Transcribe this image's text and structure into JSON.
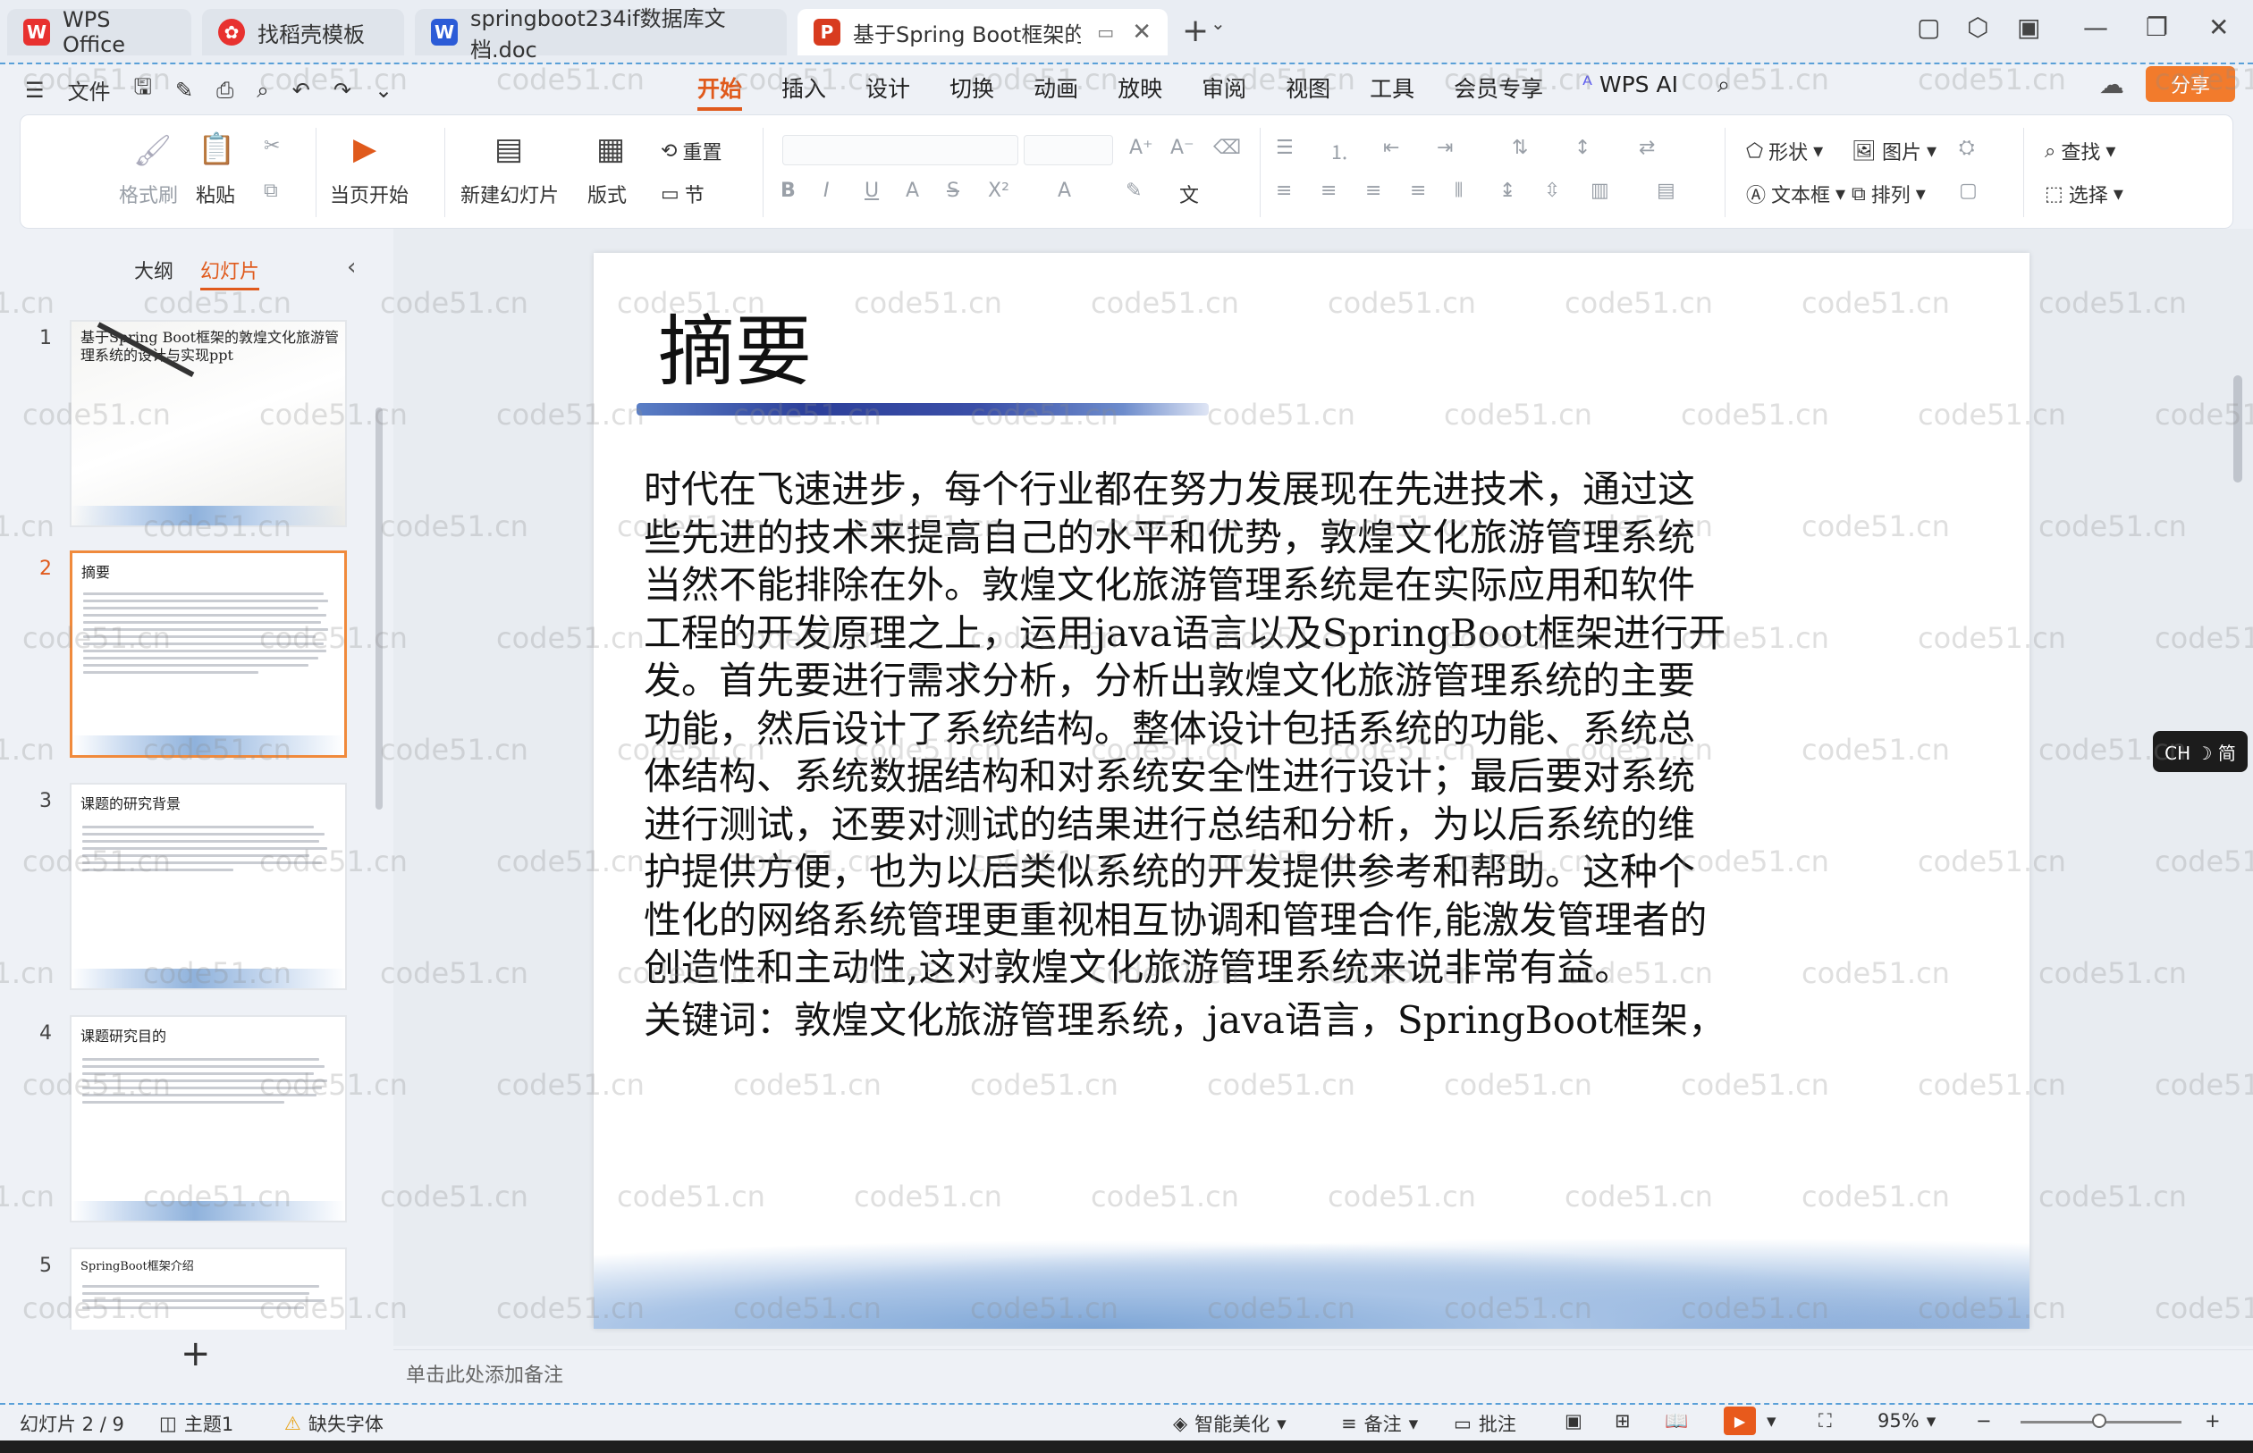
{
  "tabs": [
    {
      "label": "WPS Office",
      "icon": "wps-logo-icon",
      "active": false
    },
    {
      "label": "找稻壳模板",
      "icon": "docer-icon",
      "active": false
    },
    {
      "label": "springboot234if数据库文档.doc",
      "icon": "word-doc-icon",
      "active": false
    },
    {
      "label": "基于Spring Boot框架的敦煌",
      "icon": "ppt-doc-icon",
      "active": true
    }
  ],
  "menu": {
    "file_label": "文件",
    "tabs": [
      "开始",
      "插入",
      "设计",
      "切换",
      "动画",
      "放映",
      "审阅",
      "视图",
      "工具",
      "会员专享"
    ],
    "active_tab": "开始",
    "wps_ai_label": "WPS AI",
    "share_label": "分享"
  },
  "ribbon": {
    "format_painter": "格式刷",
    "paste": "粘贴",
    "from_current": "当页开始",
    "new_slide": "新建幻灯片",
    "layout": "版式",
    "reset": "重置",
    "section": "节",
    "shape": "形状",
    "picture": "图片",
    "textbox": "文本框",
    "arrange": "排列",
    "find": "查找",
    "select": "选择"
  },
  "left_panel": {
    "outline_tab": "大纲",
    "slides_tab": "幻灯片",
    "active_tab": "幻灯片",
    "thumbnails": [
      {
        "num": "1",
        "title": "基于Spring Boot框架的敦煌文化旅游管理系统的设计与实现ppt"
      },
      {
        "num": "2",
        "title": "摘要"
      },
      {
        "num": "3",
        "title": "课题的研究背景"
      },
      {
        "num": "4",
        "title": "课题研究目的"
      },
      {
        "num": "5",
        "title": "SpringBoot框架介绍"
      }
    ],
    "active_index": 2
  },
  "slide": {
    "title": "摘要",
    "body_lines": [
      "时代在飞速进步，每个行业都在努力发展现在先进技术，通过这",
      "些先进的技术来提高自己的水平和优势，敦煌文化旅游管理系统",
      "当然不能排除在外。敦煌文化旅游管理系统是在实际应用和软件",
      "工程的开发原理之上，运用java语言以及SpringBoot框架进行开",
      "发。首先要进行需求分析，分析出敦煌文化旅游管理系统的主要",
      "功能，然后设计了系统结构。整体设计包括系统的功能、系统总",
      "体结构、系统数据结构和对系统安全性进行设计；最后要对系统",
      "进行测试，还要对测试的结果进行总结和分析，为以后系统的维",
      "护提供方便，也为以后类似系统的开发提供参考和帮助。这种个",
      "性化的网络系统管理更重视相互协调和管理合作,能激发管理者的",
      "创造性和主动性,这对敦煌文化旅游管理系统来说非常有益。"
    ],
    "keywords": "关键词：敦煌文化旅游管理系统，java语言，SpringBoot框架，"
  },
  "notes_placeholder": "单击此处添加备注",
  "ime_indicator": "CH ☽ 简",
  "status": {
    "slide_counter": "幻灯片 2 / 9",
    "theme": "主题1",
    "missing_font": "缺失字体",
    "smart_beautify": "智能美化",
    "notes": "备注",
    "comments": "批注",
    "zoom": "95%"
  },
  "watermark_text": "code51.cn",
  "colors": {
    "accent": "#e05a1c",
    "share_button": "#f27b2c",
    "wps_red": "#e8312f",
    "word_blue": "#2b5bd7",
    "ppt_red": "#d83b1f"
  }
}
